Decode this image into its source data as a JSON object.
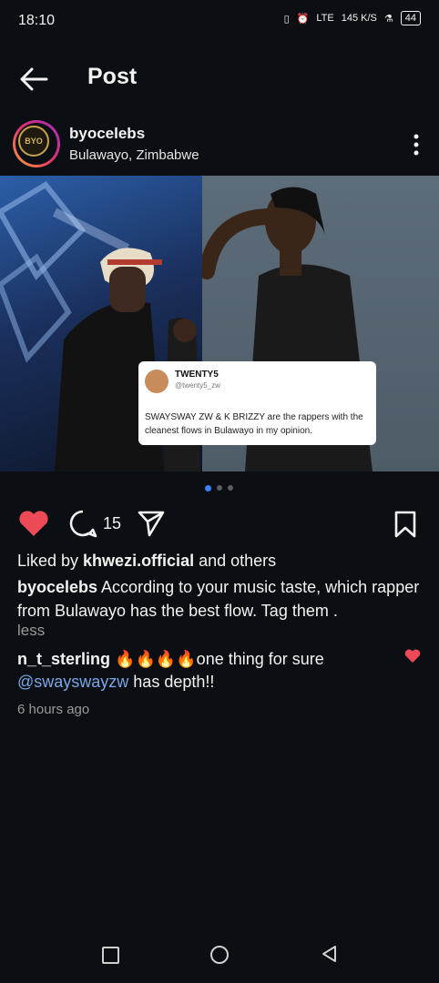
{
  "status_bar": {
    "time": "18:10",
    "lte": "LTE",
    "speed": "145 K/S",
    "battery": "44"
  },
  "header": {
    "title": "Post"
  },
  "post": {
    "username": "byocelebs",
    "location": "Bulawayo, Zimbabwe",
    "avatar_text": "BYO",
    "tweet": {
      "name": "TWENTY5",
      "handle": "@twenty5_zw",
      "text": "SWAYSWAY ZW & K BRIZZY are the rappers with the cleanest flows in Bulawayo in my opinion."
    },
    "comment_count": "15",
    "likes_prefix": "Liked by ",
    "likes_user": "khwezi.official",
    "likes_suffix": " and others",
    "caption_user": "byocelebs",
    "caption_text": " According to your music taste, which rapper from Bulawayo has the best flow. Tag them .",
    "less_label": "less",
    "comment": {
      "user": "n_t_sterling",
      "text": " 🔥🔥🔥🔥one thing for sure ",
      "mention": "@swayswayzw",
      "text_end": " has depth!!"
    },
    "timestamp": "6 hours ago"
  },
  "colors": {
    "background": "#0b0f14",
    "like_red": "#ed4956",
    "mention_blue": "#7aa7e6",
    "active_dot": "#3b82f6"
  },
  "icons": [
    "back-arrow-icon",
    "more-vertical-icon",
    "heart-icon",
    "comment-icon",
    "share-icon",
    "bookmark-icon"
  ]
}
